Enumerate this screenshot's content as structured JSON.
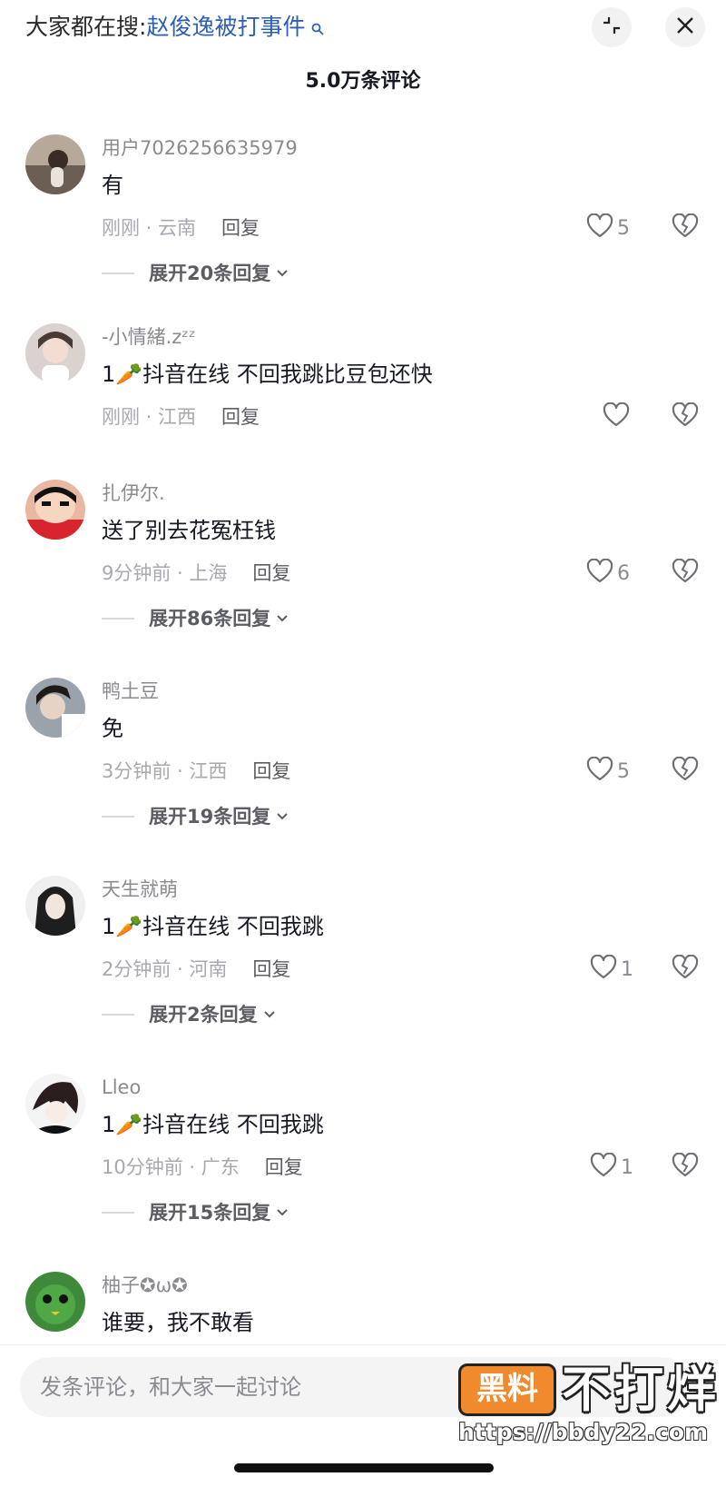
{
  "header": {
    "search_prefix": "大家都在搜:",
    "search_keyword": "赵俊逸被打事件",
    "comment_count": "5.0万条评论"
  },
  "comments": [
    {
      "username": "用户7026256635979",
      "text": "有",
      "time_location": "刚刚 · 云南",
      "reply_label": "回复",
      "likes": "5",
      "expand_label": "展开20条回复"
    },
    {
      "username": "-小情緒.zᶻᶻ",
      "text": "1🥕抖音在线 不回我跳比豆包还快",
      "time_location": "刚刚 · 江西",
      "reply_label": "回复",
      "likes": "",
      "expand_label": ""
    },
    {
      "username": "扎伊尔.",
      "text": "送了别去花冤枉钱",
      "time_location": "9分钟前 · 上海",
      "reply_label": "回复",
      "likes": "6",
      "expand_label": "展开86条回复"
    },
    {
      "username": "鸭土豆",
      "text": "免",
      "time_location": "3分钟前 · 江西",
      "reply_label": "回复",
      "likes": "5",
      "expand_label": "展开19条回复"
    },
    {
      "username": "天生就萌",
      "text": "1🥕抖音在线 不回我跳",
      "time_location": "2分钟前 · 河南",
      "reply_label": "回复",
      "likes": "1",
      "expand_label": "展开2条回复"
    },
    {
      "username": "Lleo",
      "text": "1🥕抖音在线 不回我跳",
      "time_location": "10分钟前 · 广东",
      "reply_label": "回复",
      "likes": "1",
      "expand_label": "展开15条回复"
    },
    {
      "username": "柚子✪ω✪",
      "text": "谁要，我不敢看",
      "time_location": "",
      "reply_label": "",
      "likes": "",
      "expand_label": ""
    }
  ],
  "input": {
    "placeholder": "发条评论，和大家一起讨论"
  },
  "watermark": {
    "badge": "黑料",
    "title": "不打烊",
    "url": "https://bbdy22.com"
  },
  "icons": {
    "search": "magnifier-icon",
    "collapse": "collapse-icon",
    "close": "close-icon",
    "like": "heart-icon",
    "dislike": "broken-heart-icon",
    "expand": "chevron-down-icon"
  },
  "colors": {
    "keyword": "#2d5fb6",
    "secondary_text": "#8a8b91",
    "background": "#ffffff"
  }
}
